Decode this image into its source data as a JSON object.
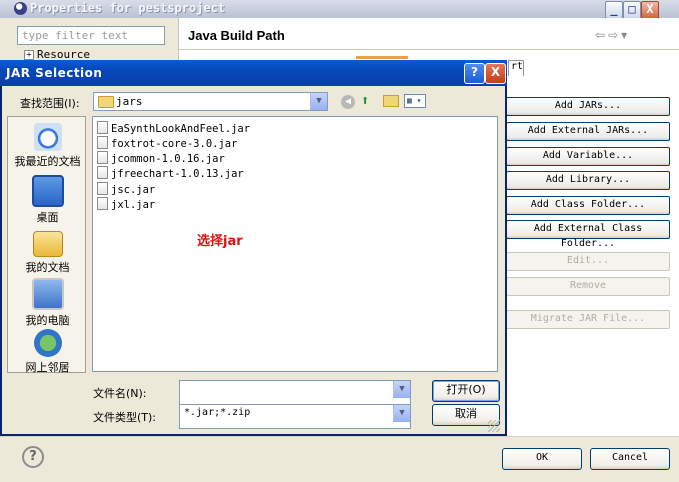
{
  "properties_window": {
    "title": "Properties for pestsproject",
    "filter_placeholder": "type filter text",
    "tree_item": "Resource",
    "page_title": "Java Build Path",
    "nav_back_label": "⇦",
    "nav_forward_label": "⇨",
    "nav_menu_label": "▾",
    "tab_stub": "rt",
    "buttons": [
      {
        "label": "Add JARs...",
        "enabled": true
      },
      {
        "label": "Add External JARs...",
        "enabled": true
      },
      {
        "label": "Add Variable...",
        "enabled": true
      },
      {
        "label": "Add Library...",
        "enabled": true
      },
      {
        "label": "Add Class Folder...",
        "enabled": true
      },
      {
        "label": "Add External Class Folder...",
        "enabled": true
      },
      {
        "label": "Edit...",
        "enabled": false
      },
      {
        "label": "Remove",
        "enabled": false
      },
      {
        "label": "Migrate JAR File...",
        "enabled": false
      }
    ],
    "ok_label": "OK",
    "cancel_label": "Cancel",
    "help_label": "?",
    "window_buttons": {
      "minimize": "_",
      "maximize": "□",
      "close": "X"
    }
  },
  "jar_dialog": {
    "title": "JAR Selection",
    "help_label": "?",
    "close_label": "X",
    "look_in_label": "查找范围(I):",
    "look_in_value": "jars",
    "places": [
      {
        "label": "我最近的文档",
        "icon": "recent-documents-icon"
      },
      {
        "label": "桌面",
        "icon": "desktop-icon"
      },
      {
        "label": "我的文档",
        "icon": "my-documents-icon"
      },
      {
        "label": "我的电脑",
        "icon": "my-computer-icon"
      },
      {
        "label": "网上邻居",
        "icon": "network-places-icon"
      }
    ],
    "files": [
      "EaSynthLookAndFeel.jar",
      "foxtrot-core-3.0.jar",
      "jcommon-1.0.16.jar",
      "jfreechart-1.0.13.jar",
      "jsc.jar",
      "jxl.jar"
    ],
    "annotation": "选择jar",
    "file_name_label": "文件名(N):",
    "file_name_value": "",
    "file_type_label": "文件类型(T):",
    "file_type_value": "*.jar;*.zip",
    "open_label": "打开(O)",
    "cancel_label": "取消"
  },
  "colors": {
    "dialog_title": "#0a53d0",
    "annotation": "#e01010",
    "xp_close": "#d2643f"
  }
}
